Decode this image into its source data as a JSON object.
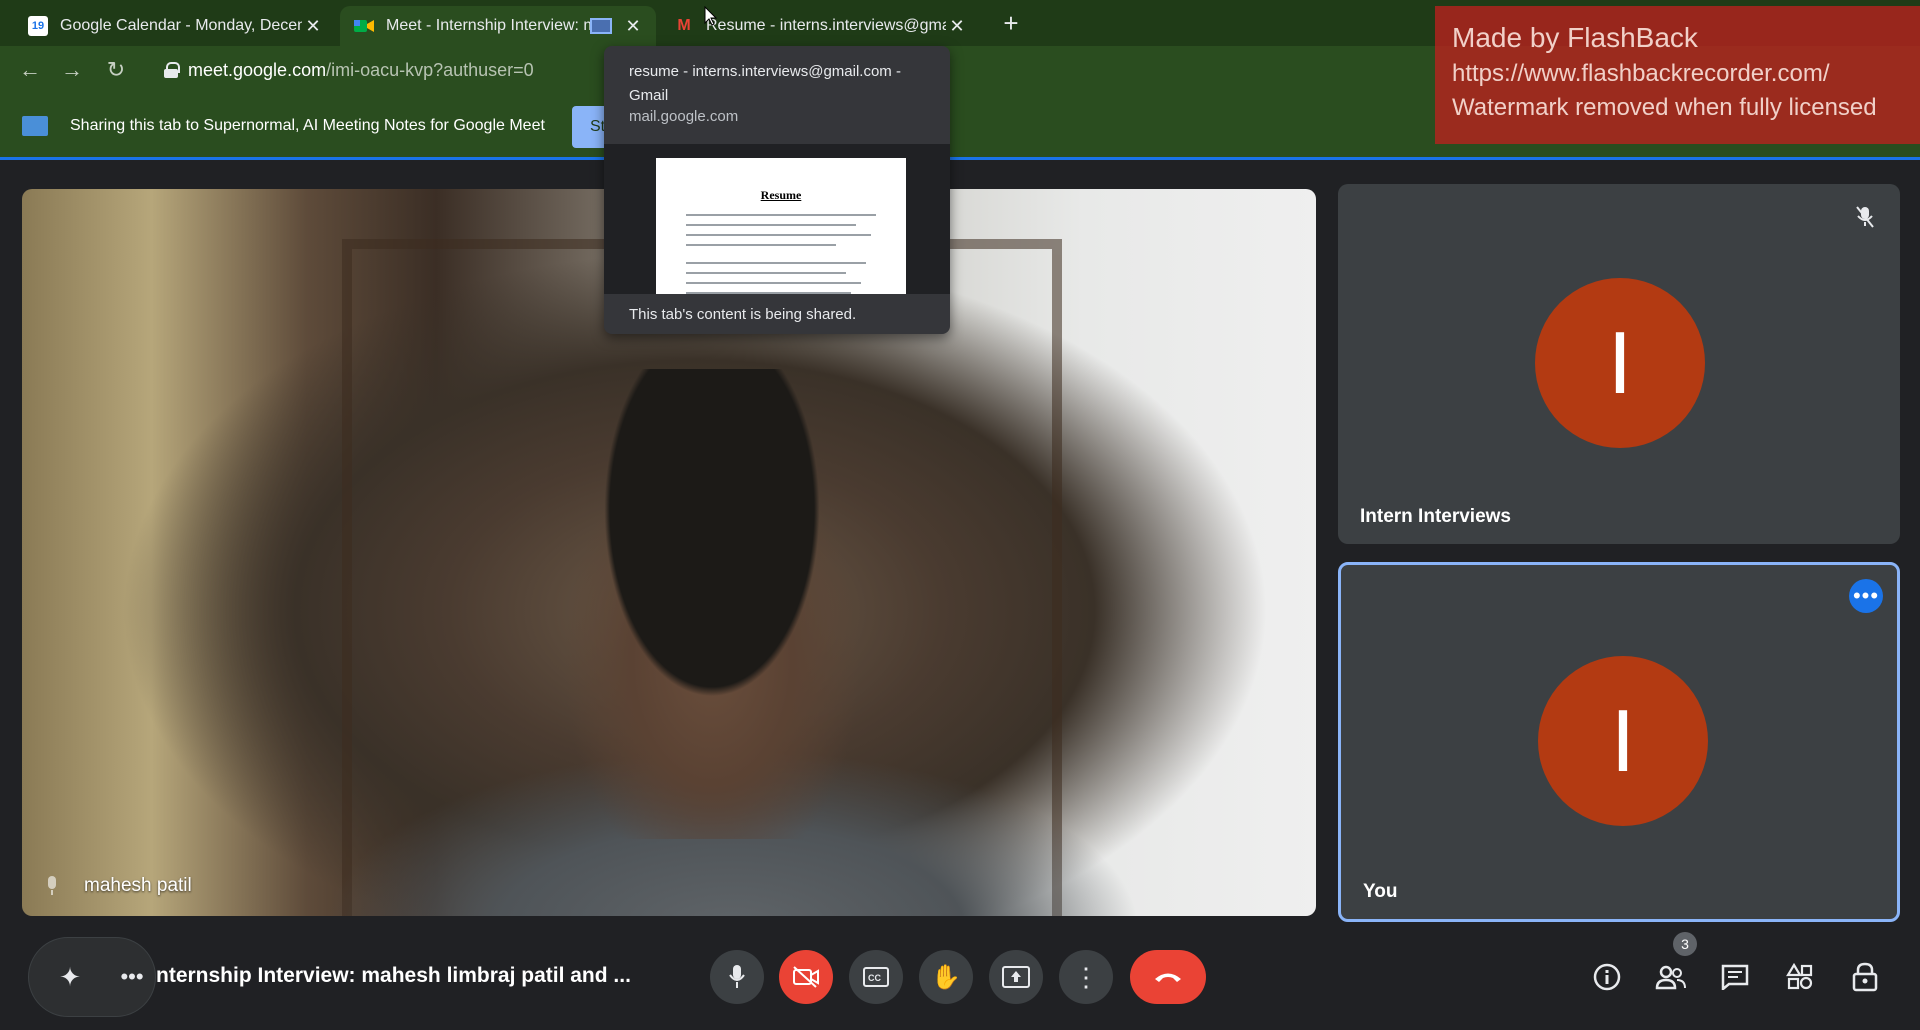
{
  "tabs": [
    {
      "label": "Google Calendar - Monday, Decemb",
      "favicon": "calendar-icon",
      "favicon_text": "19"
    },
    {
      "label": "Meet - Internship Interview: ma",
      "favicon": "meet-icon",
      "favicon_text": ""
    },
    {
      "label": "Resume - interns.interviews@gmail.c",
      "favicon": "gmail-icon",
      "favicon_text": "M"
    }
  ],
  "toolbar": {
    "url_host": "meet.google.com",
    "url_path": "/imi-oacu-kvp?authuser=0"
  },
  "infobar": {
    "message": "Sharing this tab to Supernormal, AI Meeting Notes for Google Meet",
    "stop_label": "St"
  },
  "hovercard": {
    "title": "resume - interns.interviews@gmail.com - Gmail",
    "domain": "mail.google.com",
    "thumb_heading": "Resume",
    "footer": "This tab's content is being shared."
  },
  "main_video": {
    "participant_name": "mahesh patil"
  },
  "tiles": [
    {
      "name": "Intern Interviews",
      "avatar_letter": "I",
      "muted": true
    },
    {
      "name": "You",
      "avatar_letter": "I",
      "active": true
    }
  ],
  "controls": {
    "meeting_title": "nternship Interview: mahesh limbraj patil and ...",
    "participants_count": "3"
  },
  "watermark": {
    "line1": "Made by FlashBack",
    "line2": "https://www.flashbackrecorder.com/",
    "line3": "Watermark removed when fully licensed"
  },
  "colors": {
    "brand_red": "#ea4335",
    "avatar_orange": "#b33a12",
    "accent_blue": "#8ab4f8",
    "chrome_green": "#2a4d1f"
  }
}
